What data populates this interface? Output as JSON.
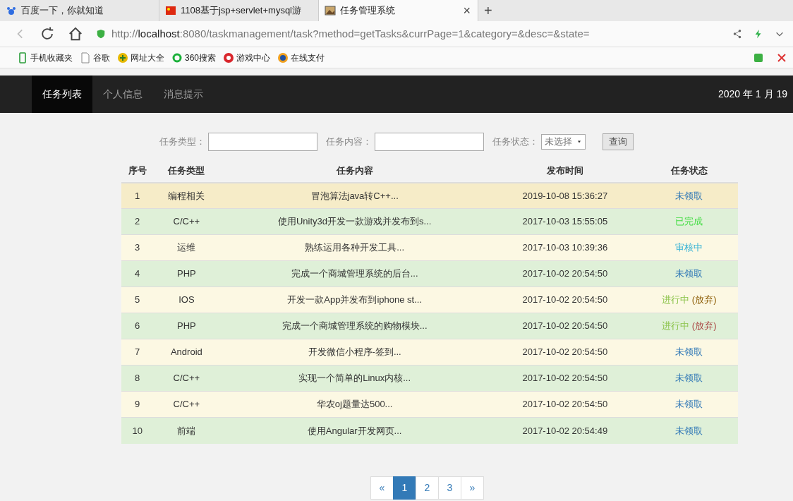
{
  "browser": {
    "tabs": [
      {
        "title": "百度一下，你就知道",
        "selected": false
      },
      {
        "title": "1108基于jsp+servlet+mysql游",
        "selected": false
      },
      {
        "title": "任务管理系统",
        "selected": true
      }
    ],
    "close": "×",
    "new_tab": "+",
    "url": {
      "scheme": "http://",
      "host": "localhost",
      "rest": ":8080/taskmanagement/task?method=getTasks&currPage=1&category=&desc=&state="
    },
    "bookmarks": [
      "手机收藏夹",
      "谷歌",
      "网址大全",
      "360搜索",
      "游戏中心",
      "在线支付"
    ]
  },
  "nav": {
    "items": [
      {
        "label": "任务列表",
        "selected": true
      },
      {
        "label": "个人信息",
        "selected": false
      },
      {
        "label": "消息提示",
        "selected": false
      }
    ],
    "date": "2020 年 1 月 19"
  },
  "filters": {
    "category_label": "任务类型：",
    "content_label": "任务内容：",
    "state_label": "任务状态：",
    "state_value": "未选择",
    "query": "查询"
  },
  "table": {
    "columns": [
      "序号",
      "任务类型",
      "任务内容",
      "发布时间",
      "任务状态"
    ],
    "rows": [
      {
        "no": "1",
        "type": "编程相关",
        "content": "冒泡算法java转C++...",
        "time": "2019-10-08 15:36:27",
        "status": [
          {
            "text": "未领取",
            "color": "#337ab7"
          }
        ],
        "hovered": true
      },
      {
        "no": "2",
        "type": "C/C++",
        "content": "使用Unity3d开发一款游戏并发布到s...",
        "time": "2017-10-03 15:55:05",
        "status": [
          {
            "text": "已完成",
            "color": "#44dd44"
          }
        ],
        "hovered": false
      },
      {
        "no": "3",
        "type": "运维",
        "content": "熟练运用各种开发工具...",
        "time": "2017-10-03 10:39:36",
        "status": [
          {
            "text": "审核中",
            "color": "#31b0d5"
          }
        ],
        "hovered": false
      },
      {
        "no": "4",
        "type": "PHP",
        "content": "完成一个商城管理系统的后台...",
        "time": "2017-10-02 20:54:50",
        "status": [
          {
            "text": "未领取",
            "color": "#337ab7"
          }
        ],
        "hovered": false
      },
      {
        "no": "5",
        "type": "IOS",
        "content": "开发一款App并发布到iphone st...",
        "time": "2017-10-02 20:54:50",
        "status": [
          {
            "text": "进行中",
            "color": "#8bc34a"
          },
          {
            "text": "(放弃)",
            "color": "#8a5a00"
          }
        ],
        "hovered": false
      },
      {
        "no": "6",
        "type": "PHP",
        "content": "完成一个商城管理系统的购物模块...",
        "time": "2017-10-02 20:54:50",
        "status": [
          {
            "text": "进行中",
            "color": "#8bc34a"
          },
          {
            "text": "(放弃)",
            "color": "#a94442"
          }
        ],
        "hovered": false
      },
      {
        "no": "7",
        "type": "Android",
        "content": "开发微信小程序-签到...",
        "time": "2017-10-02 20:54:50",
        "status": [
          {
            "text": "未领取",
            "color": "#337ab7"
          }
        ],
        "hovered": false
      },
      {
        "no": "8",
        "type": "C/C++",
        "content": "实现一个简单的Linux内核...",
        "time": "2017-10-02 20:54:50",
        "status": [
          {
            "text": "未领取",
            "color": "#337ab7"
          }
        ],
        "hovered": false
      },
      {
        "no": "9",
        "type": "C/C++",
        "content": "华农oj题量达500...",
        "time": "2017-10-02 20:54:50",
        "status": [
          {
            "text": "未领取",
            "color": "#337ab7"
          }
        ],
        "hovered": false
      },
      {
        "no": "10",
        "type": "前端",
        "content": "使用Angular开发网页...",
        "time": "2017-10-02 20:54:49",
        "status": [
          {
            "text": "未领取",
            "color": "#337ab7"
          }
        ],
        "hovered": false
      }
    ]
  },
  "pagination": {
    "prev": "«",
    "pages": [
      {
        "label": "1",
        "selected": true
      },
      {
        "label": "2",
        "selected": false
      },
      {
        "label": "3",
        "selected": false
      }
    ],
    "next": "»"
  }
}
